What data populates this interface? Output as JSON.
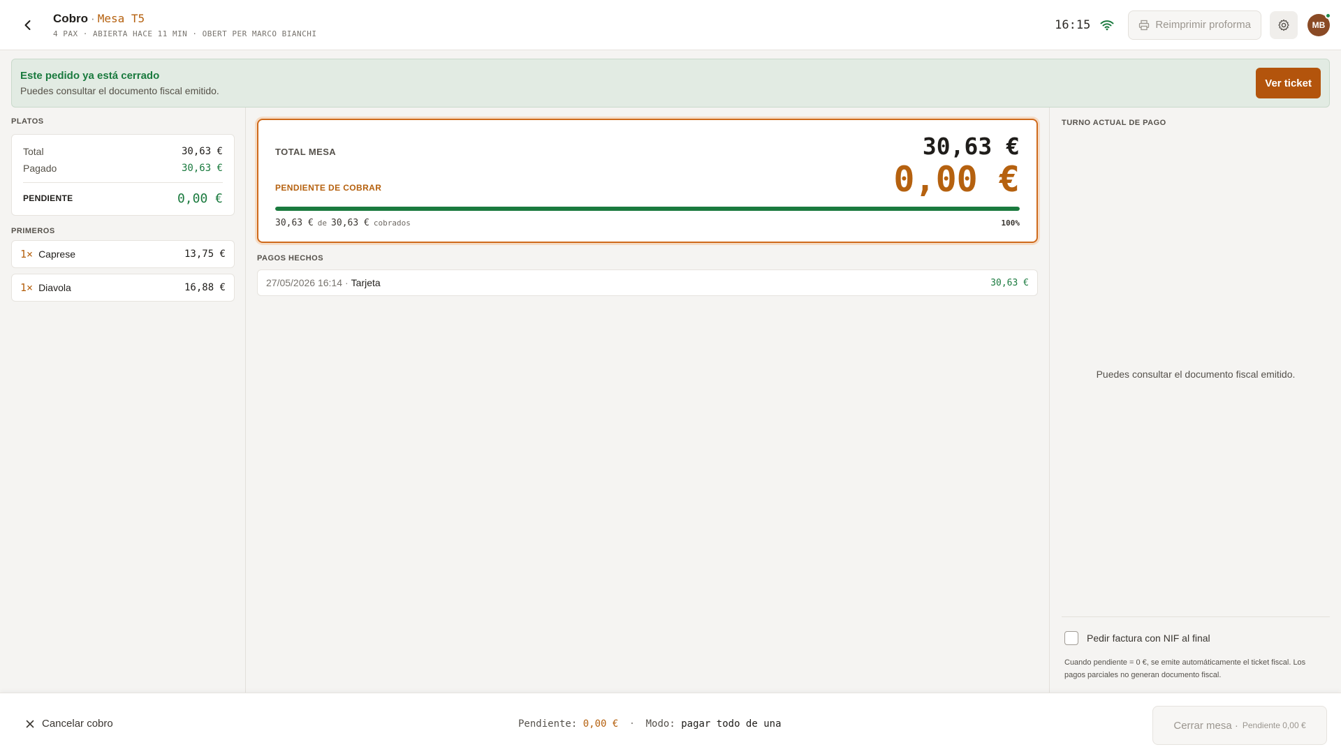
{
  "header": {
    "title": "Cobro",
    "separator": "·",
    "table": "Mesa T5",
    "subtitle": "4 PAX · ABIERTA HACE 11 MIN · OBERT PER MARCO BIANCHI",
    "clock": "16:15",
    "reprint_label": "Reimprimir proforma",
    "avatar_initials": "MB",
    "icons": [
      "back-arrow-icon",
      "wifi-icon",
      "printer-icon",
      "gear-icon"
    ]
  },
  "banner": {
    "title": "Este pedido ya está cerrado",
    "subtitle": "Puedes consultar el documento fiscal emitido.",
    "button_label": "Ver ticket"
  },
  "left": {
    "platos_label": "PLATOS",
    "summary": {
      "total_label": "Total",
      "total_value": "30,63 €",
      "paid_label": "Pagado",
      "paid_value": "30,63 €",
      "pending_label": "PENDIENTE",
      "pending_value": "0,00 €"
    },
    "group_label": "PRIMEROS",
    "dishes": [
      {
        "qty": "1×",
        "name": "Caprese",
        "price": "13,75 €"
      },
      {
        "qty": "1×",
        "name": "Diavola",
        "price": "16,88 €"
      }
    ]
  },
  "middle": {
    "total_mesa_label": "TOTAL MESA",
    "total_mesa_value": "30,63 €",
    "pending_label": "PENDIENTE DE COBRAR",
    "pending_value": "0,00 €",
    "progress_fraction": 1.0,
    "progress_collected": "30,63 €",
    "progress_de": "de",
    "progress_total": "30,63 €",
    "progress_suffix": "cobrados",
    "progress_pct": "100%",
    "payments_label": "PAGOS HECHOS",
    "payments": [
      {
        "timestamp": "27/05/2026 16:14",
        "method": "Tarjeta",
        "amount": "30,63 €"
      }
    ]
  },
  "right": {
    "label": "TURNO ACTUAL DE PAGO",
    "empty_text": "Puedes consultar el documento fiscal emitido.",
    "nif_label": "Pedir factura con NIF al final",
    "note": "Cuando pendiente = 0 €, se emite automáticamente el ticket fiscal. Los pagos parciales no generan documento fiscal."
  },
  "footer": {
    "cancel_label": "Cancelar cobro",
    "pending_label": "Pendiente:",
    "pending_value": "0,00 €",
    "mode_label": "Modo:",
    "mode_value": "pagar todo de una",
    "close_label": "Cerrar mesa ·",
    "close_sub": "Pendiente 0,00 €"
  },
  "colors": {
    "accent": "#b5610f",
    "success": "#1a7a3e",
    "banner_bg": "#e2ebe3",
    "avatar": "#8a4a25"
  }
}
